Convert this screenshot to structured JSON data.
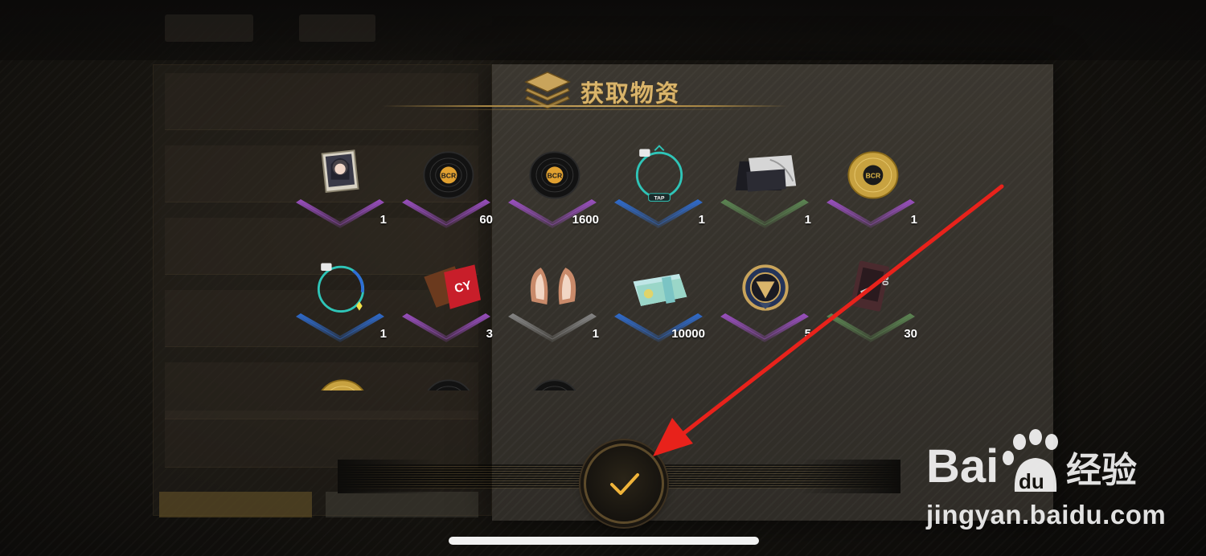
{
  "popup": {
    "title": "获取物资"
  },
  "items": [
    {
      "icon": "character-portrait-icon",
      "count": "1",
      "rarity": "purple"
    },
    {
      "icon": "bcr-vinyl-record-icon",
      "count": "60",
      "rarity": "purple"
    },
    {
      "icon": "bcr-vinyl-record-icon",
      "count": "1600",
      "rarity": "purple"
    },
    {
      "icon": "tap-avatar-frame-icon",
      "count": "1",
      "rarity": "blue"
    },
    {
      "icon": "business-card-icon",
      "count": "1",
      "rarity": "green"
    },
    {
      "icon": "bcr-gold-record-icon",
      "count": "1",
      "rarity": "purple"
    },
    {
      "icon": "avatar-frame-ring-icon",
      "count": "1",
      "rarity": "blue"
    },
    {
      "icon": "chocolate-bar-icon",
      "count": "3",
      "rarity": "purple"
    },
    {
      "icon": "fox-ears-icon",
      "count": "1",
      "rarity": "grey"
    },
    {
      "icon": "banknote-bundle-icon",
      "count": "10000",
      "rarity": "blue"
    },
    {
      "icon": "emblem-badge-icon",
      "count": "5",
      "rarity": "purple"
    },
    {
      "icon": "cassette-card-icon",
      "count": "30",
      "rarity": "green"
    },
    {
      "icon": "bcr-gold-record-icon",
      "count": "",
      "rarity": "none"
    },
    {
      "icon": "bcr-vinyl-record-icon",
      "count": "",
      "rarity": "none"
    },
    {
      "icon": "bcr-vinyl-record-icon",
      "count": "",
      "rarity": "none"
    }
  ],
  "rarity_colors": {
    "purple": "#a052c9",
    "blue": "#2f6fd6",
    "green": "#5e8a55",
    "grey": "#8a8a8a",
    "none": "#000000"
  },
  "watermark": {
    "logo_text": "Bai",
    "logo_text2": "du",
    "logo_cn": "经验",
    "site": "jingyan.baidu.com"
  }
}
